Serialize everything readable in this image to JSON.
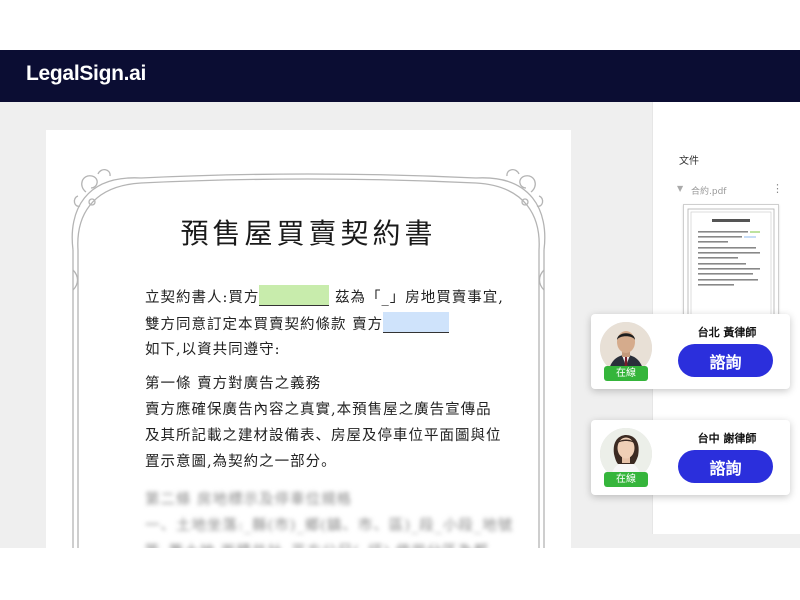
{
  "app": {
    "logo_text": "LegalSign.ai"
  },
  "document": {
    "title": "預售屋買賣契約書",
    "line1_prefix": "立契約書人:買方",
    "line1_blank": "________",
    "line1_suffix": "茲為「_」房地買賣事宜,",
    "line2_prefix": "雙方同意訂定本買賣契約條款 賣方",
    "line3": "如下,以資共同遵守:",
    "article1_title": "第一條 賣方對廣告之義務",
    "article1_line1": "賣方應確保廣告內容之真實,本預售屋之廣告宣傳品",
    "article1_line2": "及其所記載之建材設備表、房屋及停車位平面圖與位",
    "article1_line3": "置示意圖,為契約之一部分。",
    "blurred_line1": "第二條 房地標示及停車位規格",
    "blurred_line2": "一、土地坐落:_縣(市)_鄉(鎮、市、區)_段_小段_地號",
    "blurred_line3": "等_筆土地,面積共計_平方公尺(_坪),使用分區為都"
  },
  "sidebar": {
    "files_label": "文件",
    "file_name": "合約.pdf",
    "file_menu": "⋮",
    "file_arrow": "▼"
  },
  "lawyers": [
    {
      "name": "台北 黃律師",
      "status": "在線",
      "button_label": "諮詢"
    },
    {
      "name": "台中 謝律師",
      "status": "在線",
      "button_label": "諮詢"
    }
  ],
  "colors": {
    "header": "#0b0d33",
    "consult_button": "#2b2fdc",
    "online_badge": "#35b53b",
    "highlight_buyer": "#c8ecac",
    "highlight_seller": "#cfe3fb"
  }
}
